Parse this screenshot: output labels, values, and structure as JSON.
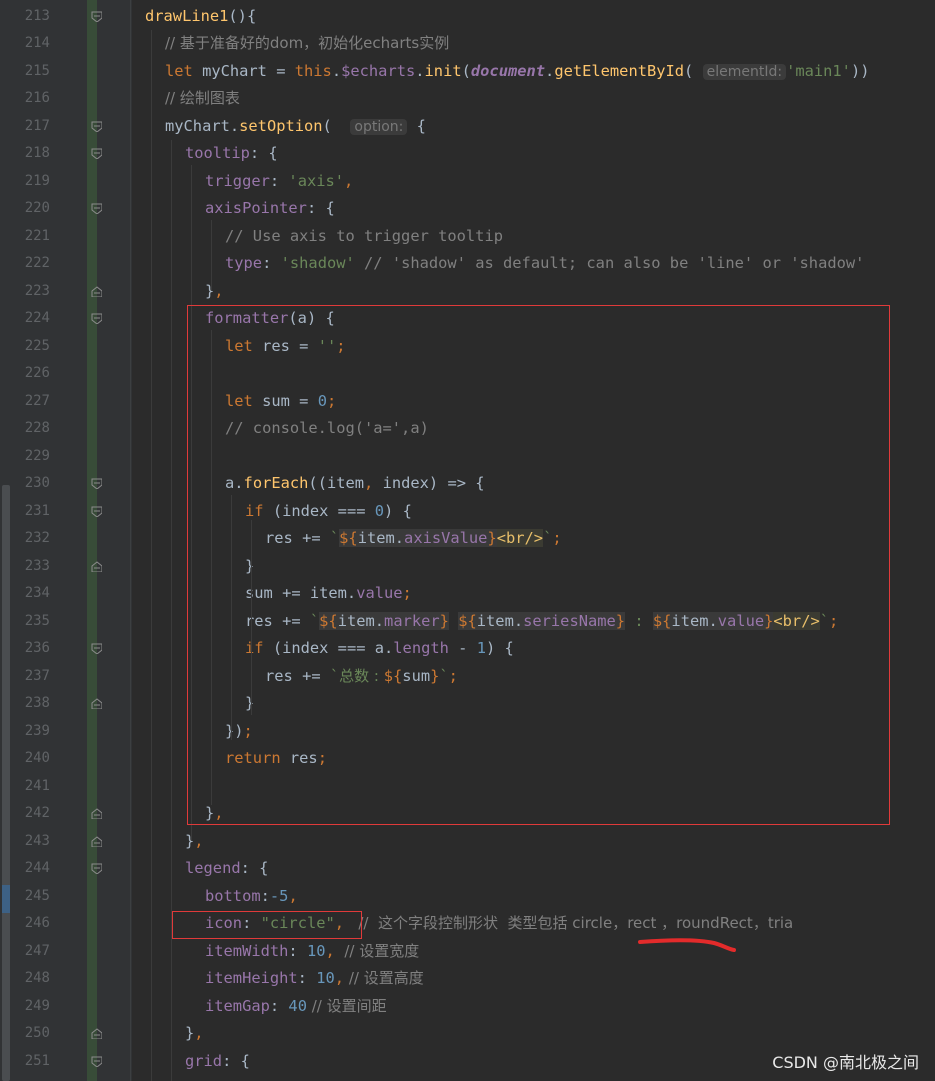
{
  "editor": {
    "line_numbers": [
      "213",
      "214",
      "215",
      "216",
      "217",
      "218",
      "219",
      "220",
      "221",
      "222",
      "223",
      "224",
      "225",
      "226",
      "227",
      "228",
      "229",
      "230",
      "231",
      "232",
      "233",
      "234",
      "235",
      "236",
      "237",
      "238",
      "239",
      "240",
      "241",
      "242",
      "243",
      "244",
      "245",
      "246",
      "247",
      "248",
      "249",
      "250",
      "251"
    ],
    "code": {
      "l213": {
        "fn": "drawLine1",
        "rest": "(){"
      },
      "l214": "// 基于准备好的dom，初始化echarts实例",
      "l215": {
        "let": "let",
        "var": " myChart = ",
        "this": "this",
        "dot1": ".",
        "echarts": "$echarts",
        "dot2": ".",
        "init": "init",
        "paren": "(",
        "doc": "document",
        "dot3": ".",
        "getById": "getElementById",
        "paren2": "(",
        "hint": "elementId:",
        "arg": "'main1'",
        "close": "))"
      },
      "l216": "// 绘制图表",
      "l217": {
        "obj": "myChart.",
        "fn": "setOption",
        "paren": "(",
        "hint": "option:",
        "brace": "{"
      },
      "l218": {
        "prop": "tooltip",
        "rest": ": {"
      },
      "l219": {
        "prop": "trigger",
        "colon": ": ",
        "str": "'axis'",
        "comma": ","
      },
      "l220": {
        "prop": "axisPointer",
        "rest": ": {"
      },
      "l221": "// Use axis to trigger tooltip",
      "l222": {
        "prop": "type",
        "colon": ": ",
        "str": "'shadow'",
        "cmt": " // 'shadow' as default; can also be 'line' or 'shadow'"
      },
      "l223": {
        "brace": "}",
        "comma": ","
      },
      "l224": {
        "prop": "formatter",
        "rest": "(a) {"
      },
      "l225": {
        "let": "let",
        "var": " res = ",
        "str": "''",
        "semi": ";"
      },
      "l227": {
        "let": "let",
        "var": " sum = ",
        "num": "0",
        "semi": ";"
      },
      "l228": "// console.log('a=',a)",
      "l230": {
        "obj": "a.",
        "fn": "forEach",
        "p1": "((item",
        "comma": ",",
        "p2": " index) => {"
      },
      "l231": {
        "kw": "if",
        "p1": " (index === ",
        "num": "0",
        "p2": ") {"
      },
      "l232": {
        "pre": "res += ",
        "tick": "`",
        "ob": "${",
        "obj": "item.",
        "prop": "axisValue",
        "cb": "}",
        "tag": "<br/>",
        "tick2": "`",
        "semi": ";"
      },
      "l233": "}",
      "l234": {
        "pre": "sum += item.",
        "prop": "value",
        "semi": ";"
      },
      "l235": {
        "pre": "res += ",
        "tick": "`",
        "ob1": "${",
        "obj1": "item.",
        "prop1": "marker",
        "cb1": "}",
        "sp": " ",
        "ob2": "${",
        "obj2": "item.",
        "prop2": "seriesName",
        "cb2": "}",
        "mid": " : ",
        "ob3": "${",
        "obj3": "item.",
        "prop3": "value",
        "cb3": "}",
        "tag": "<br/>",
        "tick2": "`",
        "semi": ";"
      },
      "l236": {
        "kw": "if",
        "p1": " (index === a.",
        "prop": "length",
        "p2": " - ",
        "num": "1",
        "p3": ") {"
      },
      "l237": {
        "pre": "res += ",
        "tick": "`",
        "cn": "总数 : ",
        "ob": "${",
        "var": "sum",
        "cb": "}",
        "tick2": "`",
        "semi": ";"
      },
      "l238": "}",
      "l239": {
        "p": "})",
        "semi": ";"
      },
      "l240": {
        "kw": "return",
        "var": " res",
        "semi": ";"
      },
      "l242": {
        "brace": "}",
        "comma": ","
      },
      "l243": {
        "brace": "}",
        "comma": ","
      },
      "l244": {
        "prop": "legend",
        "rest": ": {"
      },
      "l245": {
        "prop": "bottom",
        "colon": ":",
        "num": "-5",
        "comma": ","
      },
      "l246": {
        "prop": "icon",
        "colon": ": ",
        "str": "\"circle\"",
        "comma": ",",
        "cmt": "   //  这个字段控制形状  类型包括 circle，rect ，roundRect，tria"
      },
      "l247": {
        "prop": "itemWidth",
        "colon": ": ",
        "num": "10",
        "comma": ",",
        "cmt": "  // 设置宽度"
      },
      "l248": {
        "prop": "itemHeight",
        "colon": ": ",
        "num": "10",
        "comma": ",",
        "cmt": " // 设置高度"
      },
      "l249": {
        "prop": "itemGap",
        "colon": ": ",
        "num": "40",
        "cmt": " // 设置间距"
      },
      "l250": {
        "brace": "}",
        "comma": ","
      },
      "l251": {
        "prop": "grid",
        "rest": ": {"
      }
    }
  },
  "colors": {
    "background": "#2b2b2b",
    "gutter": "#313335",
    "keyword": "#cc7832",
    "function": "#ffc66d",
    "property": "#9876aa",
    "string": "#6a8759",
    "number": "#6897bb",
    "comment": "#808080",
    "annotation_box": "#e03a3a"
  },
  "watermark": "CSDN @南北极之间"
}
